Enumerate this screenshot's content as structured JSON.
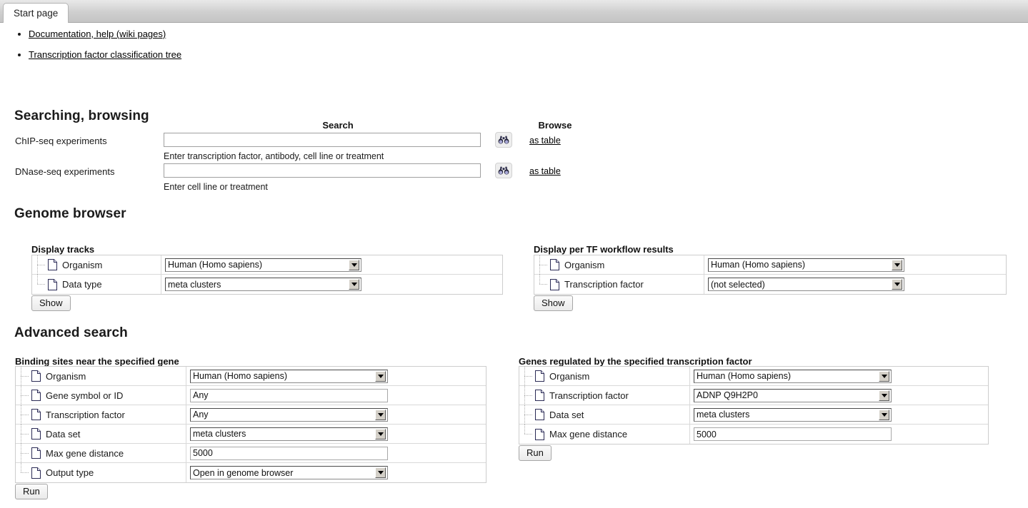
{
  "tab": {
    "label": "Start page"
  },
  "links": [
    {
      "label": "Documentation, help (wiki pages)"
    },
    {
      "label": "Transcription factor classification tree"
    }
  ],
  "searching": {
    "heading": "Searching, browsing",
    "col_search": "Search",
    "col_browse": "Browse",
    "rows": [
      {
        "label": "ChIP-seq experiments",
        "value": "",
        "placeholder": "",
        "hint": "Enter transcription factor, antibody, cell line or treatment",
        "icon": "binoculars-icon",
        "browse_label": "as table"
      },
      {
        "label": "DNase-seq experiments",
        "value": "",
        "placeholder": "",
        "hint": "Enter cell line or treatment",
        "icon": "binoculars-icon",
        "browse_label": "as table"
      }
    ]
  },
  "genome_browser": {
    "heading": "Genome browser",
    "display_tracks": {
      "title": "Display tracks",
      "rows": [
        {
          "label": "Organism",
          "type": "select",
          "value": "Human (Homo sapiens)"
        },
        {
          "label": "Data type",
          "type": "select",
          "value": "meta clusters"
        }
      ],
      "button": "Show"
    },
    "per_tf": {
      "title": "Display per TF workflow results",
      "rows": [
        {
          "label": "Organism",
          "type": "select",
          "value": "Human (Homo sapiens)"
        },
        {
          "label": "Transcription factor",
          "type": "select",
          "value": "(not selected)"
        }
      ],
      "button": "Show"
    }
  },
  "advanced_search": {
    "heading": "Advanced search",
    "binding_sites": {
      "title": "Binding sites near the specified gene",
      "rows": [
        {
          "label": "Organism",
          "type": "select",
          "value": "Human (Homo sapiens)"
        },
        {
          "label": "Gene symbol or ID",
          "type": "text",
          "value": "Any"
        },
        {
          "label": "Transcription factor",
          "type": "select",
          "value": "Any"
        },
        {
          "label": "Data set",
          "type": "select",
          "value": "meta clusters"
        },
        {
          "label": "Max gene distance",
          "type": "text",
          "value": "5000"
        },
        {
          "label": "Output type",
          "type": "select",
          "value": "Open in genome browser"
        }
      ],
      "button": "Run"
    },
    "genes_regulated": {
      "title": "Genes regulated by the specified transcription factor",
      "rows": [
        {
          "label": "Organism",
          "type": "select",
          "value": "Human (Homo sapiens)"
        },
        {
          "label": "Transcription factor",
          "type": "select",
          "value": "ADNP Q9H2P0"
        },
        {
          "label": "Data set",
          "type": "select",
          "value": "meta clusters"
        },
        {
          "label": "Max gene distance",
          "type": "text",
          "value": "5000"
        }
      ],
      "button": "Run"
    }
  },
  "colors": {
    "tab_active_bg": "#ffffff",
    "tabbar_bg": "#cfcfcf",
    "table_border": "#cdcdcd",
    "row_divider": "#d9d9d9",
    "select_border": "#4a4a4a",
    "button_bg": "#eaeaea",
    "icon_blue": "#8f8fc0"
  }
}
